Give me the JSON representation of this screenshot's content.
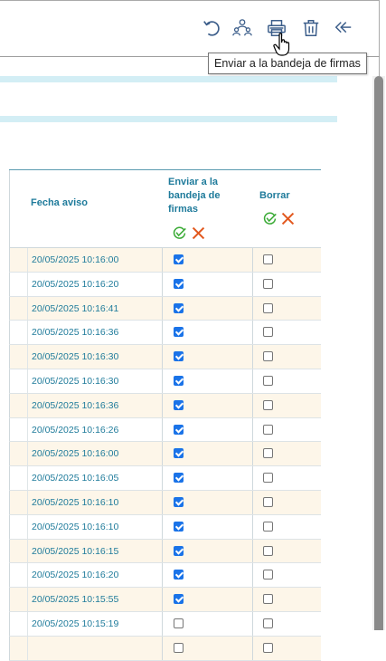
{
  "toolbar": {
    "tooltip": "Enviar a la bandeja de firmas",
    "buttons": [
      "undo-icon",
      "assign-users-icon",
      "print-tray-icon",
      "trash-icon",
      "reply-all-icon"
    ]
  },
  "table": {
    "headers": {
      "fecha": "Fecha aviso",
      "enviar": "Enviar a la bandeja de firmas",
      "borrar": "Borrar"
    },
    "rows": [
      {
        "fecha": "20/05/2025 10:16:00",
        "enviar": true,
        "borrar": false
      },
      {
        "fecha": "20/05/2025 10:16:20",
        "enviar": true,
        "borrar": false
      },
      {
        "fecha": "20/05/2025 10:16:41",
        "enviar": true,
        "borrar": false
      },
      {
        "fecha": "20/05/2025 10:16:36",
        "enviar": true,
        "borrar": false
      },
      {
        "fecha": "20/05/2025 10:16:30",
        "enviar": true,
        "borrar": false
      },
      {
        "fecha": "20/05/2025 10:16:30",
        "enviar": true,
        "borrar": false
      },
      {
        "fecha": "20/05/2025 10:16:36",
        "enviar": true,
        "borrar": false
      },
      {
        "fecha": "20/05/2025 10:16:26",
        "enviar": true,
        "borrar": false
      },
      {
        "fecha": "20/05/2025 10:16:00",
        "enviar": true,
        "borrar": false
      },
      {
        "fecha": "20/05/2025 10:16:05",
        "enviar": true,
        "borrar": false
      },
      {
        "fecha": "20/05/2025 10:16:10",
        "enviar": true,
        "borrar": false
      },
      {
        "fecha": "20/05/2025 10:16:10",
        "enviar": true,
        "borrar": false
      },
      {
        "fecha": "20/05/2025 10:16:15",
        "enviar": true,
        "borrar": false
      },
      {
        "fecha": "20/05/2025 10:16:20",
        "enviar": true,
        "borrar": false
      },
      {
        "fecha": "20/05/2025 10:15:55",
        "enviar": true,
        "borrar": false
      },
      {
        "fecha": "20/05/2025 10:15:19",
        "enviar": false,
        "borrar": false
      },
      {
        "fecha": "",
        "enviar": false,
        "borrar": false
      }
    ]
  },
  "colors": {
    "header_text": "#1f7b9b",
    "band": "#d3eef5",
    "row_alt": "#fdf6e9",
    "check_green": "#3aaa35",
    "cross_orange": "#e2581e",
    "toolbar_icon": "#3b5d8a"
  }
}
